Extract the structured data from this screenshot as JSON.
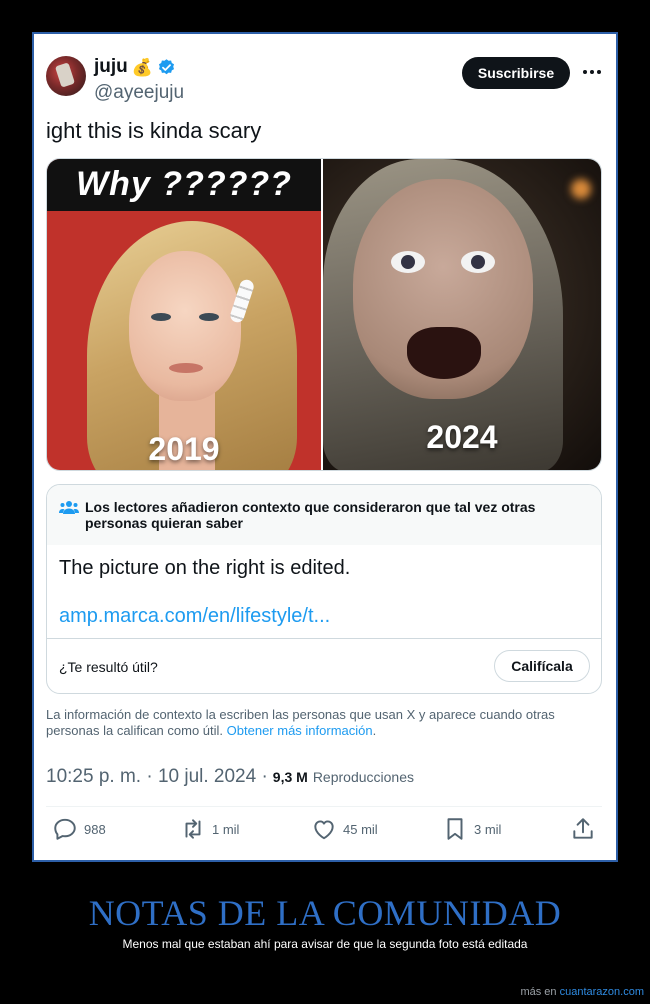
{
  "tweet": {
    "author": {
      "name": "juju",
      "emoji": "💰",
      "handle": "@ayeejuju"
    },
    "subscribe_label": "Suscribirse",
    "text": "ight this is kinda scary",
    "media": {
      "left_caption": "Why ??????",
      "left_year": "2019",
      "right_year": "2024"
    },
    "community_note": {
      "header": "Los lectores añadieron contexto que consideraron que tal vez otras personas quieran saber",
      "body": "The picture on the right is edited.",
      "link": "amp.marca.com/en/lifestyle/t...",
      "helpful_question": "¿Te resultó útil?",
      "rate_label": "Califícala"
    },
    "disclaimer": {
      "text": "La información de contexto la escriben las personas que usan X y aparece cuando otras personas la califican como útil.",
      "link": "Obtener más información",
      "end": "."
    },
    "timestamp": "10:25 p. m. · 10 jul. 2024 ·",
    "views_count": "9,3 M",
    "views_label": "Reproducciones",
    "actions": {
      "replies": "988",
      "retweets": "1 mil",
      "likes": "45 mil",
      "bookmarks": "3 mil"
    }
  },
  "caption": {
    "title": "NOTAS DE LA COMUNIDAD",
    "subtitle": "Menos mal que estaban ahí para avisar de que la segunda foto está editada"
  },
  "footer": {
    "prefix": "más en ",
    "site": "cuantarazon.com"
  },
  "colors": {
    "accent": "#1d9bf0",
    "verified": "#1d9bf0",
    "caption_title": "#2f6fc6",
    "frame_border": "#2d5fa8"
  }
}
